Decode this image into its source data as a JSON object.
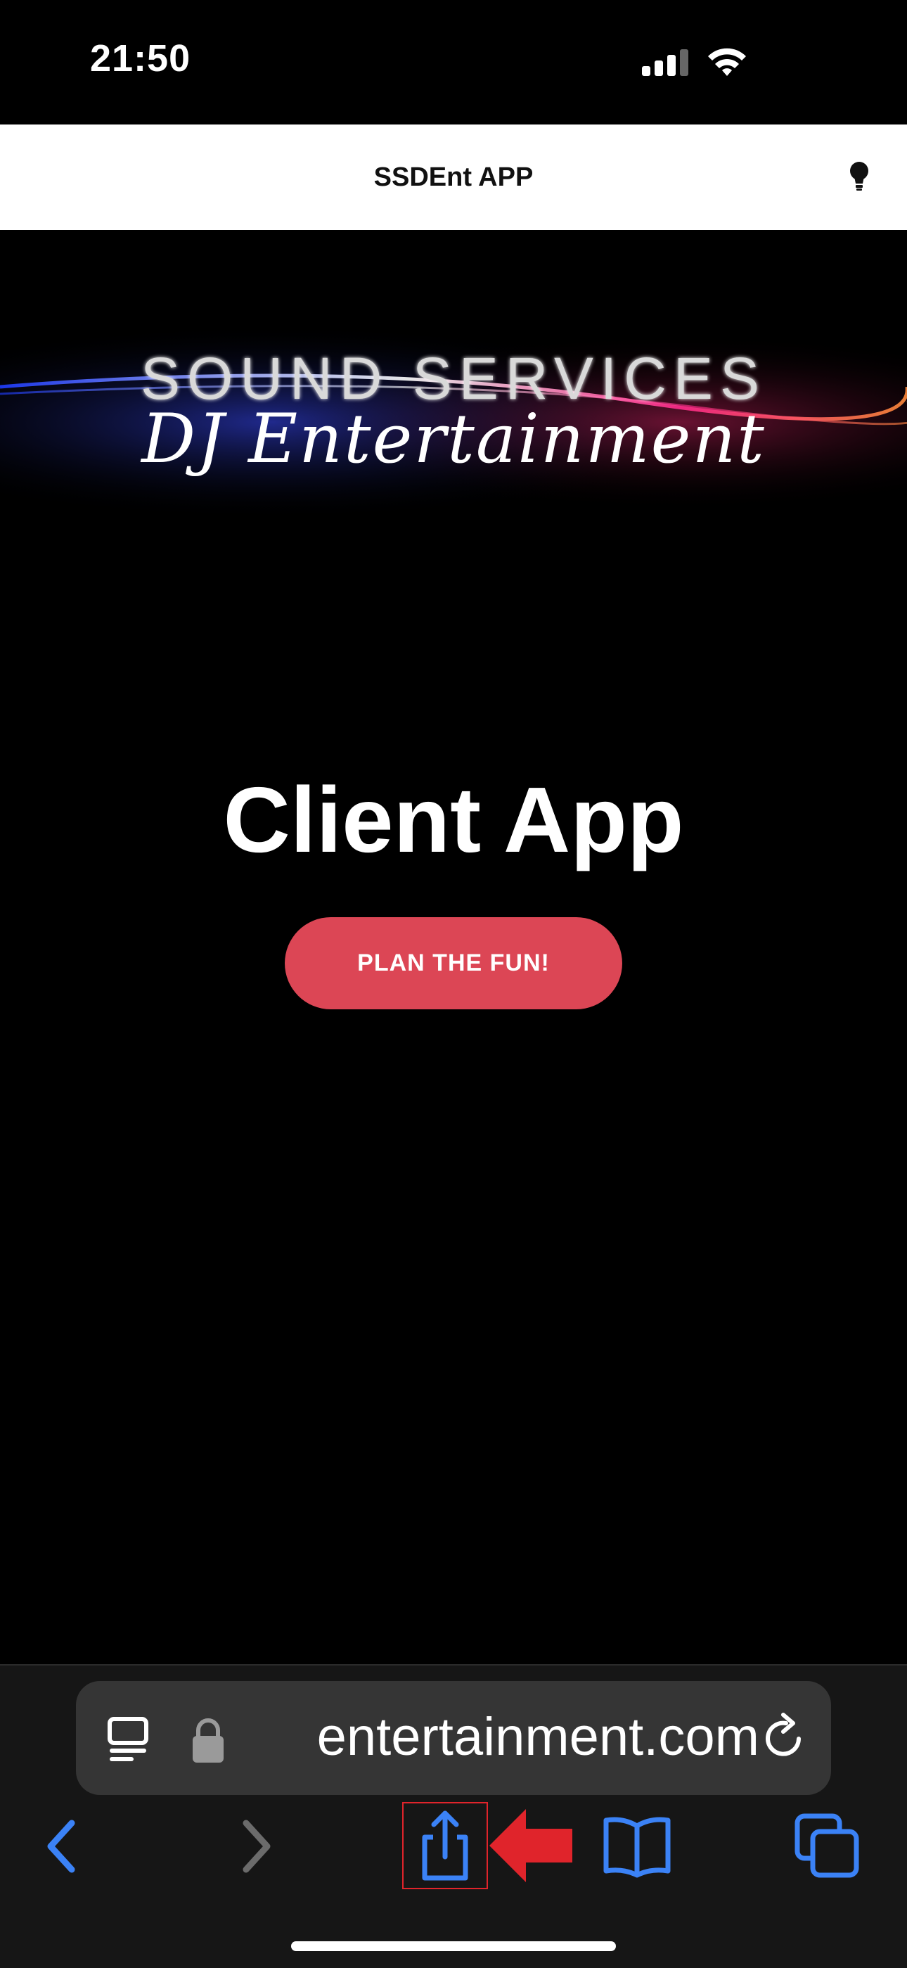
{
  "status_bar": {
    "time": "21:50"
  },
  "header": {
    "title": "SSDEnt APP"
  },
  "logo": {
    "line1": "SOUND SERVICES",
    "line2": "DJ Entertainment"
  },
  "hero": {
    "title": "Client App",
    "cta_label": "PLAN THE FUN!"
  },
  "browser": {
    "url": "entertainment.com"
  },
  "colors": {
    "accent": "#dc4655",
    "ios_blue": "#3b82f6",
    "highlight_red": "#e0242b"
  }
}
